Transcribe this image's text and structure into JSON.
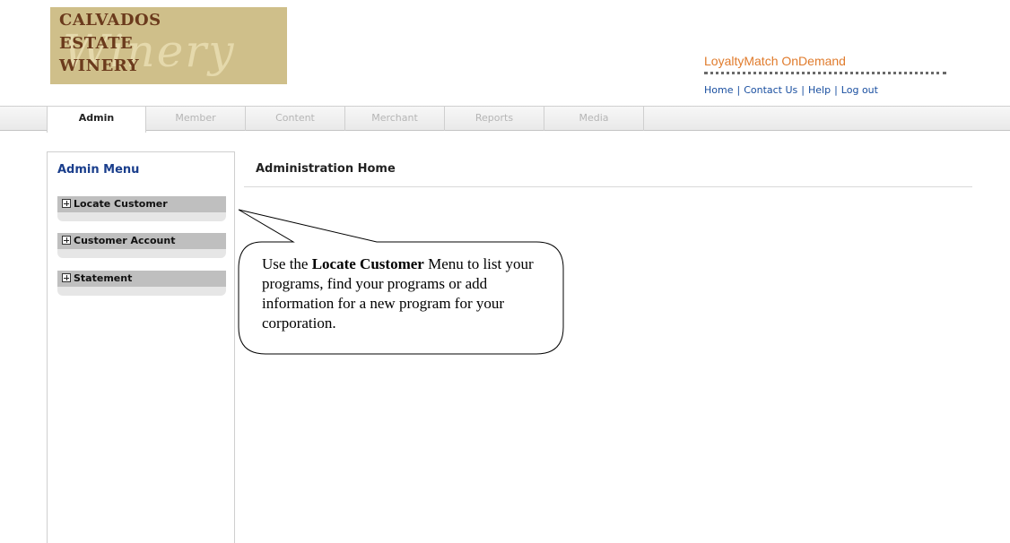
{
  "logo": {
    "line1": "CALVADOS",
    "line2": "ESTATE",
    "line3": "WINERY",
    "script": "Winery"
  },
  "brand": {
    "title": "LoyaltyMatch OnDemand"
  },
  "top_links": {
    "home": "Home",
    "contact": "Contact Us",
    "help": "Help",
    "logout": "Log out",
    "separator": "|"
  },
  "tabs": [
    {
      "label": "Admin",
      "active": true
    },
    {
      "label": "Member",
      "active": false
    },
    {
      "label": "Content",
      "active": false
    },
    {
      "label": "Merchant",
      "active": false
    },
    {
      "label": "Reports",
      "active": false
    },
    {
      "label": "Media",
      "active": false
    }
  ],
  "sidebar": {
    "title": "Admin Menu",
    "groups": [
      {
        "label": "Locate Customer",
        "icon": "plus-icon"
      },
      {
        "label": "Customer Account",
        "icon": "plus-icon"
      },
      {
        "label": "Statement",
        "icon": "plus-icon"
      }
    ]
  },
  "main": {
    "title": "Administration Home"
  },
  "callout": {
    "prefix": "Use the ",
    "bold": "Locate Customer",
    "suffix": " Menu to list your programs, find your programs or add information for a new program for your corporation."
  },
  "colors": {
    "brand_orange": "#e07b2c",
    "link_blue": "#1a4fa0",
    "sidebar_title": "#1a3e8c",
    "logo_bg": "#cfbf8a",
    "logo_text": "#6b3a1c"
  }
}
